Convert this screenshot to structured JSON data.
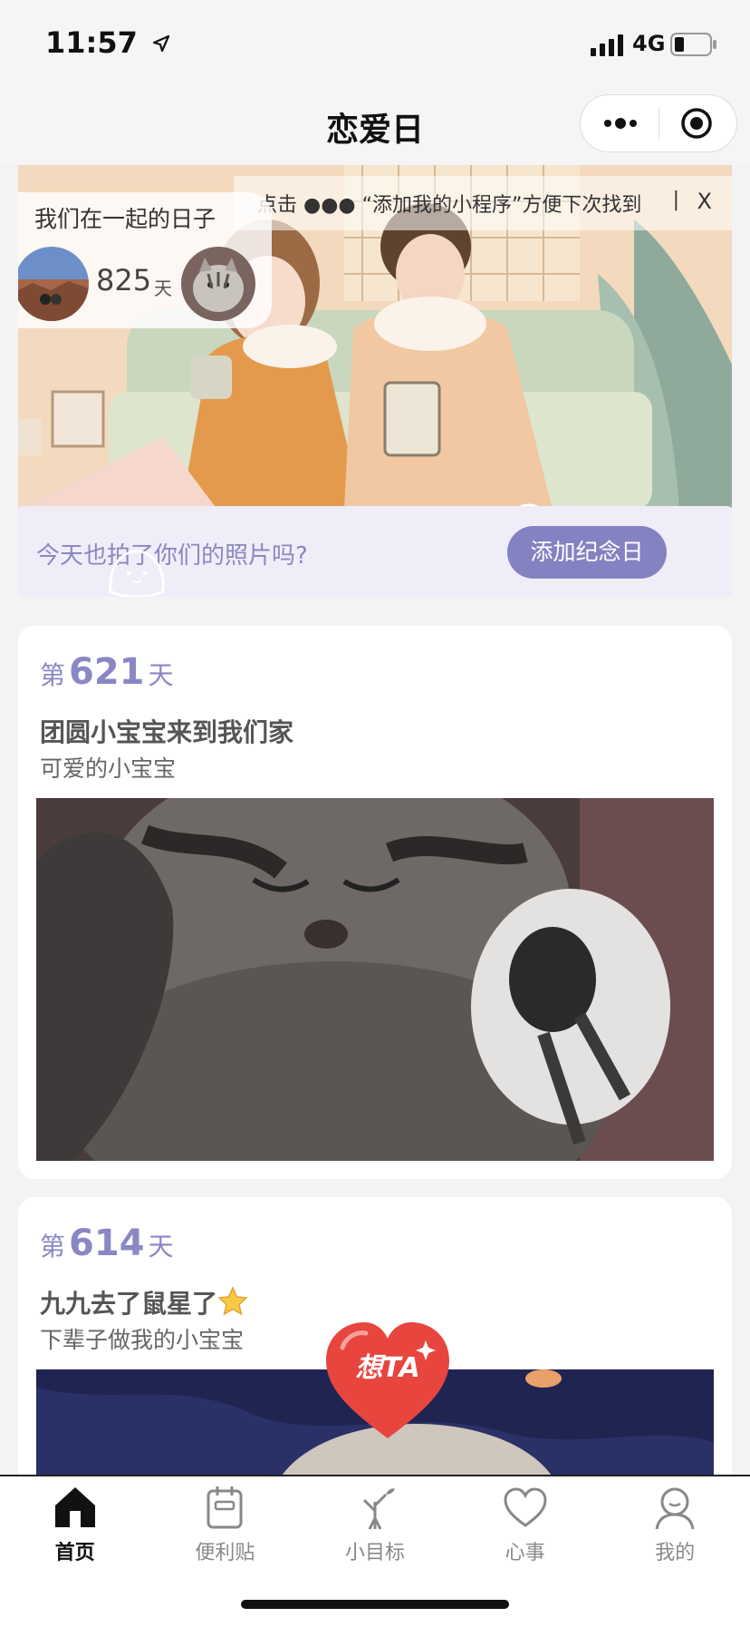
{
  "status_bar": {
    "time": "11:57",
    "network": "4G"
  },
  "nav": {
    "title": "恋爱日"
  },
  "banner": {
    "tip_text": "点击 ●●● “添加我的小程序”方便下次找到",
    "tip_divider": "|",
    "tip_close": "X",
    "counter_title": "我们在一起的日子",
    "days": "825",
    "days_unit": "天",
    "prompt": "今天也拍了你们的照片吗?",
    "add_button": "添加纪念日"
  },
  "cards": [
    {
      "day_prefix": "第",
      "day": "621",
      "day_suffix": "天",
      "title": "团圆小宝宝来到我们家",
      "subtitle": "可爱的小宝宝"
    },
    {
      "day_prefix": "第",
      "day": "614",
      "day_suffix": "天",
      "title": "九九去了鼠星了",
      "subtitle": "下辈子做我的小宝宝"
    }
  ],
  "heart_button": {
    "label": "想TA"
  },
  "tabs": [
    {
      "label": "首页",
      "icon": "home-icon",
      "active": true
    },
    {
      "label": "便利贴",
      "icon": "notepad-icon"
    },
    {
      "label": "小目标",
      "icon": "sprout-icon"
    },
    {
      "label": "心事",
      "icon": "heart-icon"
    },
    {
      "label": "我的",
      "icon": "profile-icon"
    }
  ],
  "colors": {
    "accent": "#8582c2",
    "accent_text": "#8a87c4",
    "heart": "#e8453f"
  }
}
